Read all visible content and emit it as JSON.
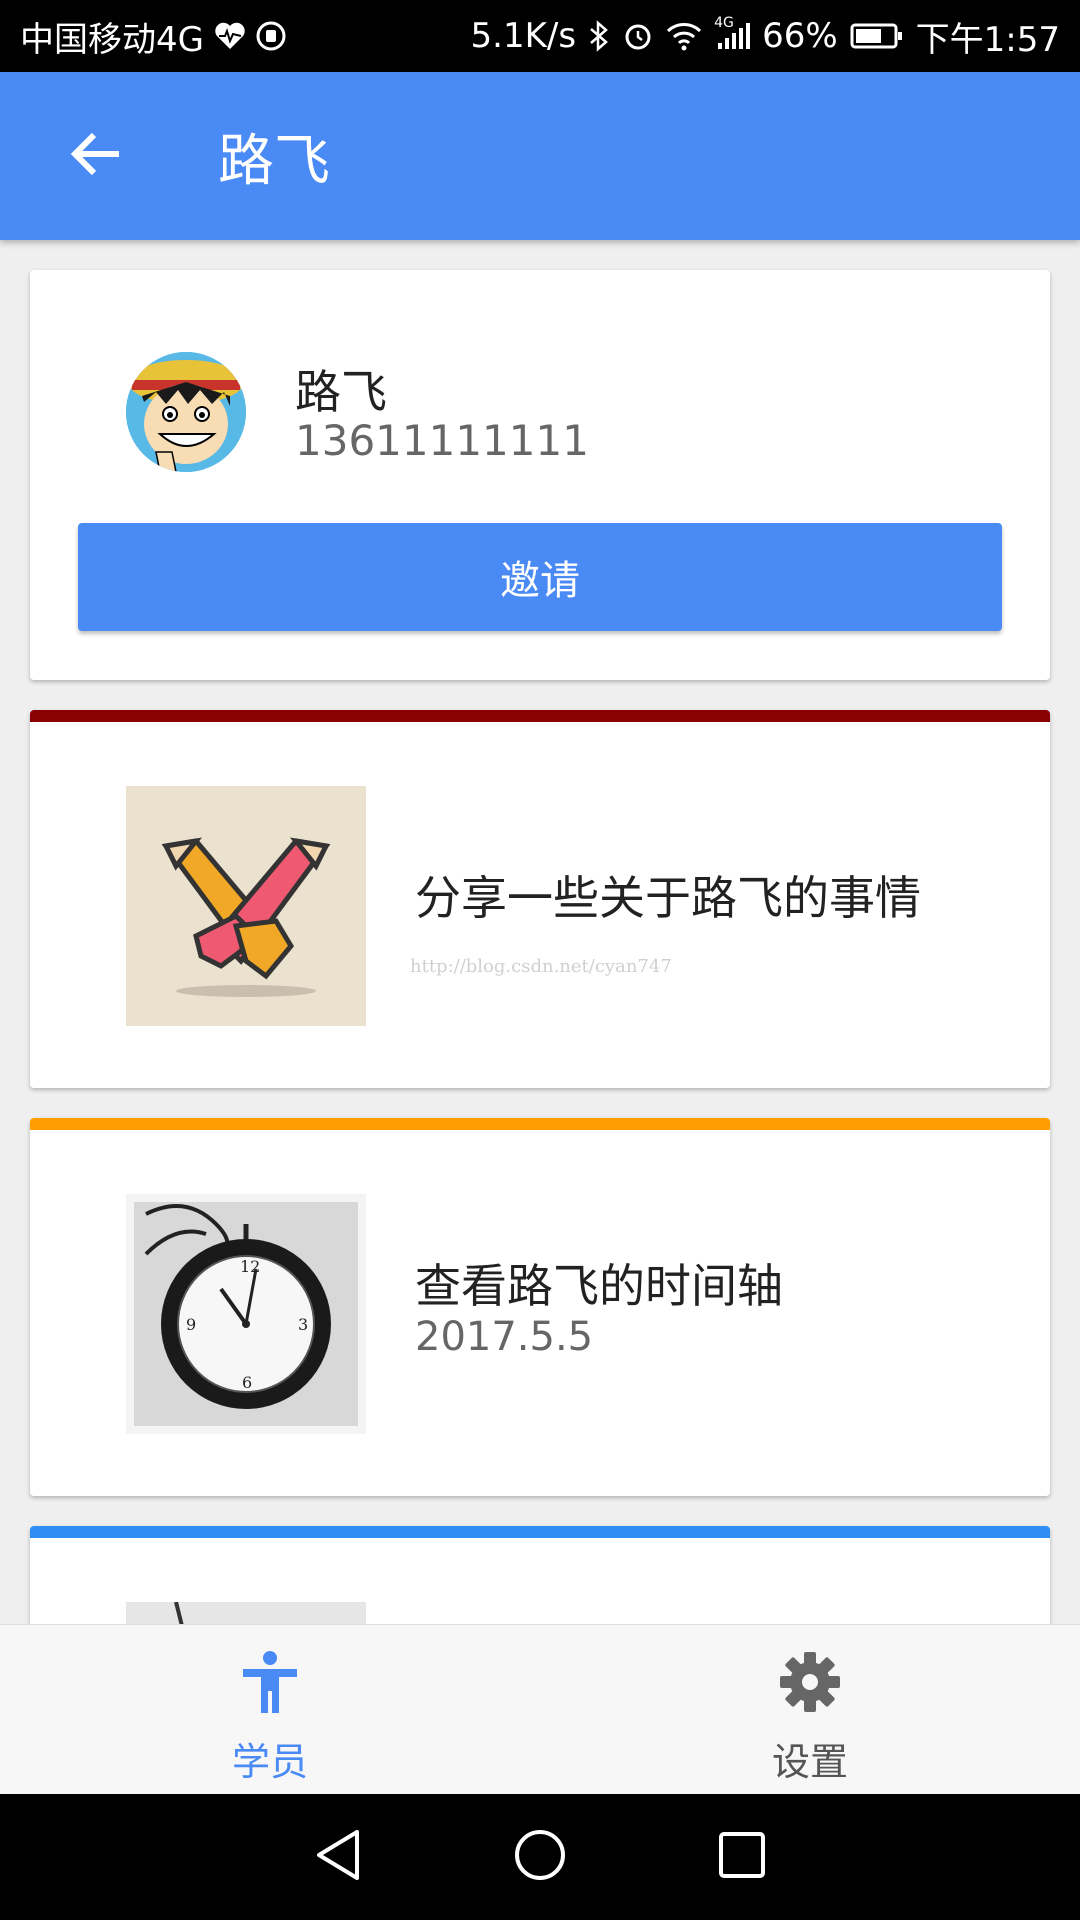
{
  "status_bar": {
    "carrier": "中国移动4G",
    "network_speed": "5.1K/s",
    "signal_label": "4G",
    "battery_percent": "66%",
    "time": "下午1:57",
    "icons": [
      "heart-pulse-icon",
      "hand-icon",
      "bluetooth-icon",
      "alarm-icon",
      "wifi-icon",
      "signal-icon",
      "battery-icon"
    ]
  },
  "app_bar": {
    "title": "路飞",
    "back_icon": "arrow-left-icon",
    "color": "#4a8af4"
  },
  "profile_card": {
    "name": "路飞",
    "phone": "13611111111",
    "invite_label": "邀请"
  },
  "items": [
    {
      "title": "分享一些关于路飞的事情",
      "subtitle": "",
      "watermark": "http://blog.csdn.net/cyan747",
      "strip_color": "#8b0000",
      "thumb_icon": "handshake-pencils-icon"
    },
    {
      "title": "查看路飞的时间轴",
      "subtitle": "2017.5.5",
      "strip_color": "#ff9d00",
      "thumb_icon": "clock-icon"
    },
    {
      "title": "",
      "subtitle": "",
      "strip_color": "#2f8ef4",
      "thumb_icon": "pen-photo-icon"
    }
  ],
  "bottom_nav": {
    "tabs": [
      {
        "label": "学员",
        "icon": "person-icon",
        "active": true
      },
      {
        "label": "设置",
        "icon": "gear-icon",
        "active": false
      }
    ],
    "active_color": "#4a8af4"
  },
  "system_nav": {
    "icons": [
      "back-triangle-icon",
      "home-circle-icon",
      "recents-square-icon"
    ]
  }
}
